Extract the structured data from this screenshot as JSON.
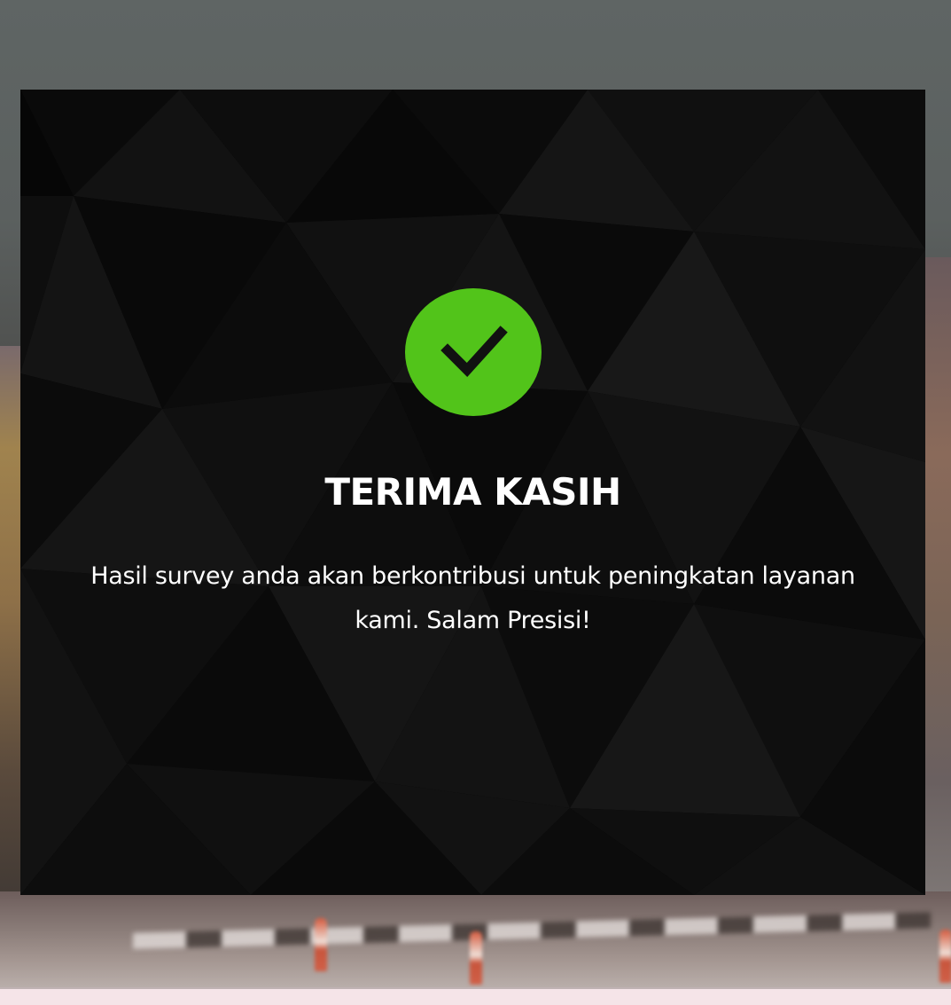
{
  "dialog": {
    "status_icon": "check-circle-icon",
    "title": "TERIMA KASIH",
    "message": "Hasil survey anda akan berkontribusi untuk peningkatan layanan kami. Salam Presisi!"
  },
  "colors": {
    "success": "#52c41a",
    "card_background": "#060606",
    "text": "#ffffff",
    "bottom_strip": "#f5e4e8"
  }
}
